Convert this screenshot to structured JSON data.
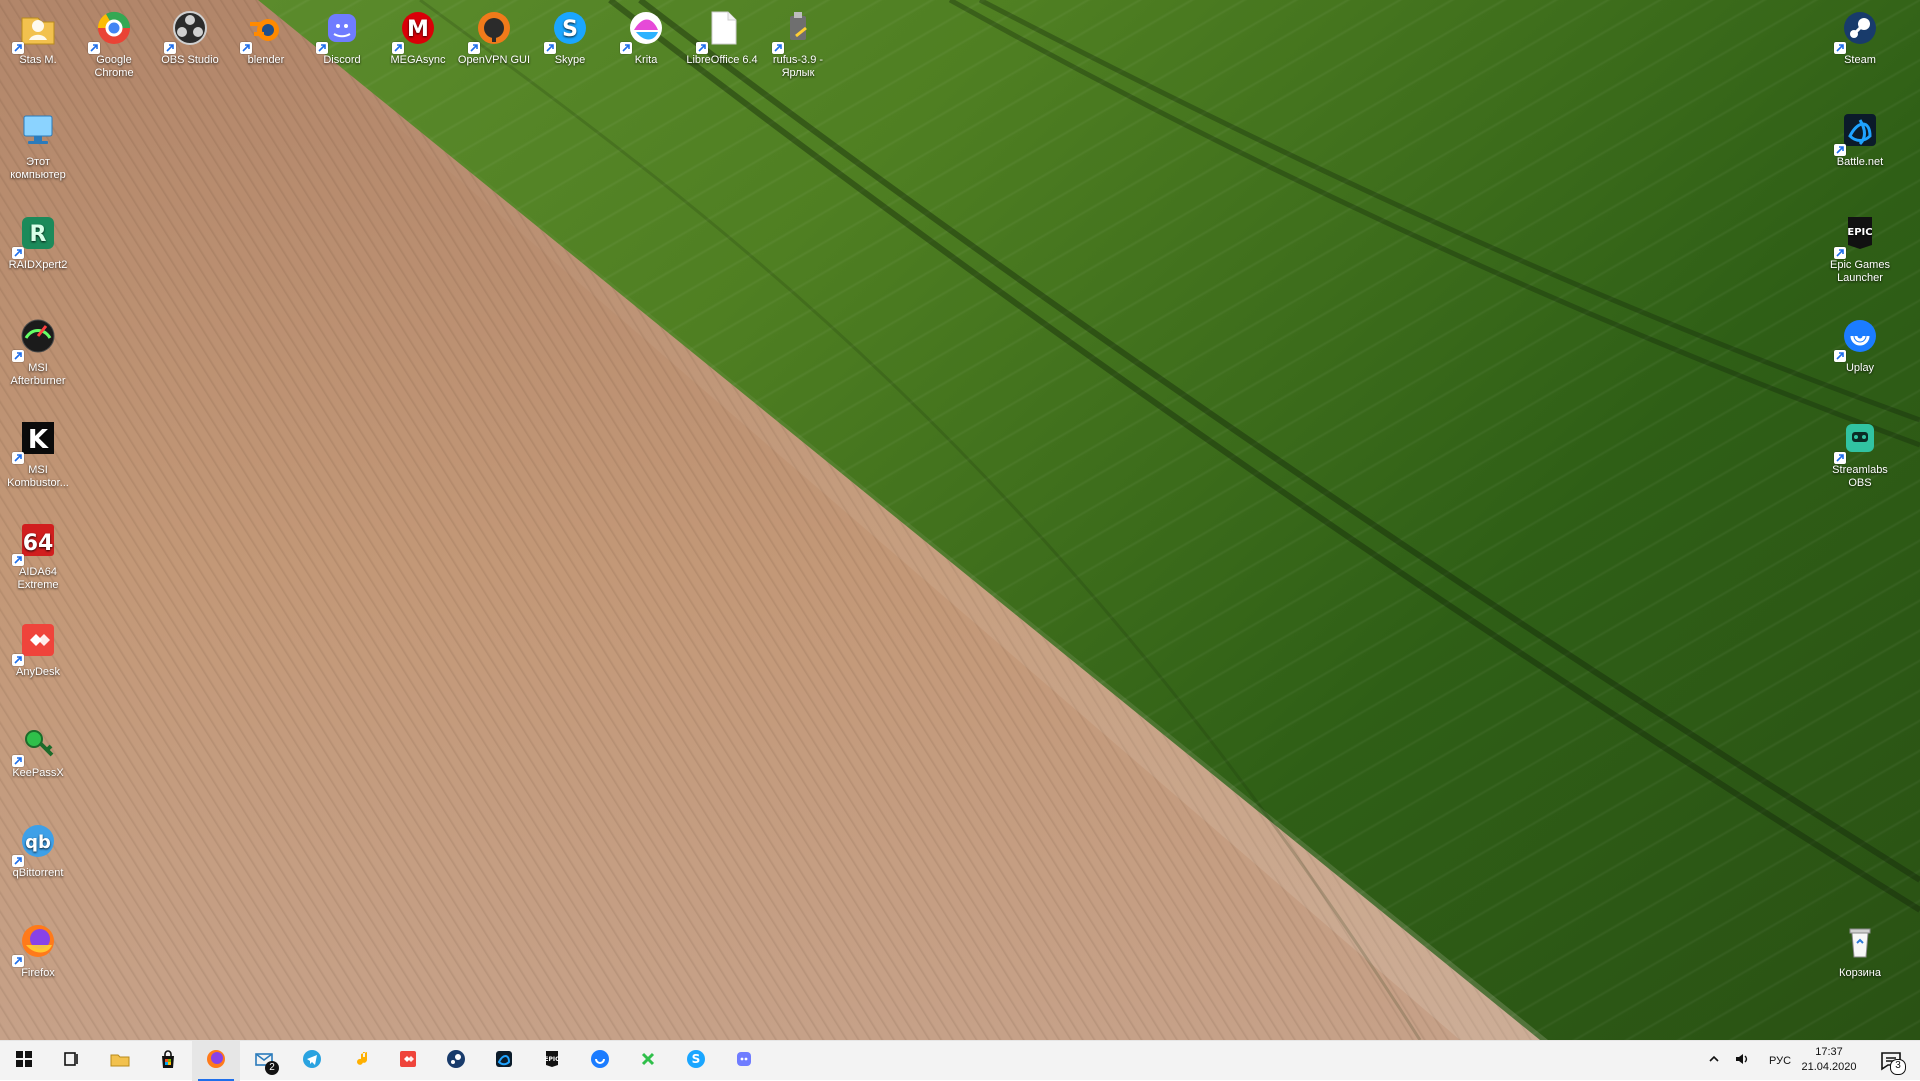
{
  "desktop": {
    "icons_left": [
      {
        "id": "stas-m",
        "label": "Stas M.",
        "icon": "user-folder-icon"
      },
      {
        "id": "this-pc",
        "label": "Этот компьютер",
        "icon": "computer-icon"
      },
      {
        "id": "raidxpert2",
        "label": "RAIDXpert2",
        "icon": "raidxpert-icon"
      },
      {
        "id": "msi-afterburner",
        "label": "MSI Afterburner",
        "icon": "afterburner-icon"
      },
      {
        "id": "msi-kombustor",
        "label": "MSI Kombustor...",
        "icon": "kombustor-icon"
      },
      {
        "id": "aida64-extreme",
        "label": "AIDA64 Extreme",
        "icon": "aida64-icon"
      },
      {
        "id": "anydesk",
        "label": "AnyDesk",
        "icon": "anydesk-icon"
      },
      {
        "id": "keepassx",
        "label": "KeePassX",
        "icon": "keepassx-icon"
      },
      {
        "id": "qbittorrent",
        "label": "qBittorrent",
        "icon": "qbittorrent-icon"
      },
      {
        "id": "firefox",
        "label": "Firefox",
        "icon": "firefox-icon"
      }
    ],
    "icons_top": [
      {
        "id": "google-chrome",
        "label": "Google Chrome",
        "icon": "chrome-icon"
      },
      {
        "id": "obs-studio",
        "label": "OBS Studio",
        "icon": "obs-icon"
      },
      {
        "id": "blender",
        "label": "blender",
        "icon": "blender-icon"
      },
      {
        "id": "discord",
        "label": "Discord",
        "icon": "discord-icon"
      },
      {
        "id": "megasync",
        "label": "MEGAsync",
        "icon": "mega-icon"
      },
      {
        "id": "openvpn-gui",
        "label": "OpenVPN GUI",
        "icon": "openvpn-icon"
      },
      {
        "id": "skype",
        "label": "Skype",
        "icon": "skype-icon"
      },
      {
        "id": "krita",
        "label": "Krita",
        "icon": "krita-icon"
      },
      {
        "id": "libreoffice",
        "label": "LibreOffice 6.4",
        "icon": "document-icon"
      },
      {
        "id": "rufus",
        "label": "rufus-3.9 - Ярлык",
        "icon": "usb-drive-icon"
      }
    ],
    "icons_right": [
      {
        "id": "steam",
        "label": "Steam",
        "icon": "steam-icon"
      },
      {
        "id": "battle-net",
        "label": "Battle.net",
        "icon": "battlenet-icon"
      },
      {
        "id": "epic-games-launcher",
        "label": "Epic Games Launcher",
        "icon": "epic-games-icon"
      },
      {
        "id": "uplay",
        "label": "Uplay",
        "icon": "uplay-icon"
      },
      {
        "id": "streamlabs-obs",
        "label": "Streamlabs OBS",
        "icon": "streamlabs-icon"
      },
      {
        "id": "recycle-bin",
        "label": "Корзина",
        "icon": "recycle-bin-icon"
      }
    ]
  },
  "taskbar": {
    "buttons": [
      {
        "id": "start",
        "icon": "windows-start-icon",
        "active": false
      },
      {
        "id": "task-view",
        "icon": "task-view-icon",
        "active": false
      },
      {
        "id": "file-explorer",
        "icon": "folder-icon",
        "active": false
      },
      {
        "id": "store",
        "icon": "store-bag-icon",
        "active": false
      },
      {
        "id": "firefox",
        "icon": "firefox-icon",
        "active": true
      },
      {
        "id": "mail",
        "icon": "mail-icon",
        "active": false,
        "badge": "2"
      },
      {
        "id": "telegram",
        "icon": "telegram-icon",
        "active": false
      },
      {
        "id": "music",
        "icon": "music-note-icon",
        "active": false
      },
      {
        "id": "anydesk",
        "icon": "anydesk-icon",
        "active": false
      },
      {
        "id": "steam",
        "icon": "steam-icon",
        "active": false
      },
      {
        "id": "battle-net",
        "icon": "battlenet-icon",
        "active": false
      },
      {
        "id": "epic-games",
        "icon": "epic-games-icon",
        "active": false
      },
      {
        "id": "uplay",
        "icon": "uplay-icon",
        "active": false
      },
      {
        "id": "xbox-app",
        "icon": "x-icon",
        "active": false
      },
      {
        "id": "skype",
        "icon": "skype-icon",
        "active": false
      },
      {
        "id": "discord",
        "icon": "discord-icon",
        "active": false
      }
    ],
    "tray": {
      "language": "РУС",
      "time": "17:37",
      "date": "21.04.2020",
      "notifications": "3"
    }
  },
  "colors": {
    "taskbar_bg": "#f3f3f3",
    "active_underline": "#1f6feb"
  }
}
